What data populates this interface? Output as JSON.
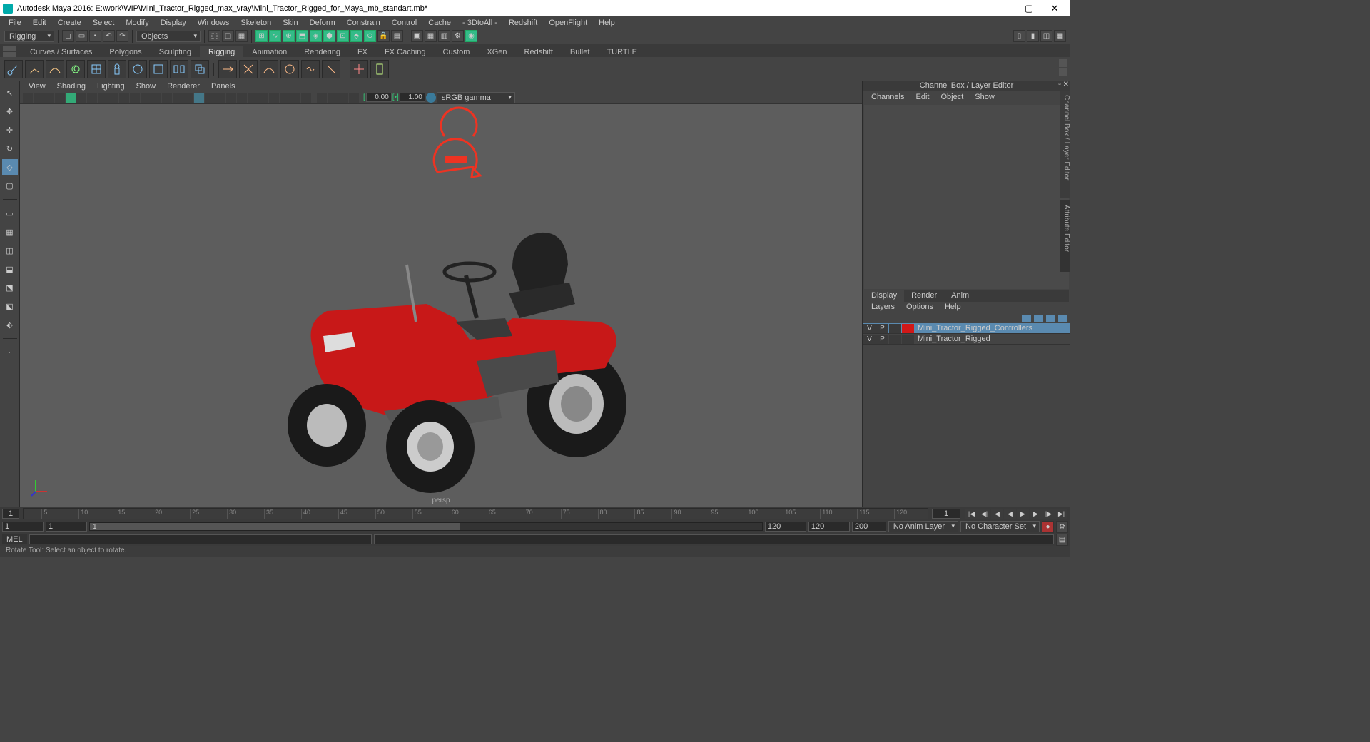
{
  "window": {
    "title": "Autodesk Maya 2016: E:\\work\\WIP\\Mini_Tractor_Rigged_max_vray\\Mini_Tractor_Rigged_for_Maya_mb_standart.mb*"
  },
  "menubar": [
    "File",
    "Edit",
    "Create",
    "Select",
    "Modify",
    "Display",
    "Windows",
    "Skeleton",
    "Skin",
    "Deform",
    "Constrain",
    "Control",
    "Cache",
    "- 3DtoAll -",
    "Redshift",
    "OpenFlight",
    "Help"
  ],
  "statusline": {
    "mode": "Rigging",
    "selmode": "Objects"
  },
  "shelf_tabs": [
    "Curves / Surfaces",
    "Polygons",
    "Sculpting",
    "Rigging",
    "Animation",
    "Rendering",
    "FX",
    "FX Caching",
    "Custom",
    "XGen",
    "Redshift",
    "Bullet",
    "TURTLE"
  ],
  "active_shelf": "Rigging",
  "panel_menus": [
    "View",
    "Shading",
    "Lighting",
    "Show",
    "Renderer",
    "Panels"
  ],
  "gamma": {
    "near": "0.00",
    "far": "1.00",
    "mode": "sRGB gamma"
  },
  "viewport": {
    "camera": "persp"
  },
  "right_panel": {
    "title": "Channel Box / Layer Editor",
    "menus": [
      "Channels",
      "Edit",
      "Object",
      "Show"
    ],
    "vtabs": [
      "Channel Box / Layer Editor",
      "Attribute Editor"
    ],
    "layer_tabs": [
      "Display",
      "Render",
      "Anim"
    ],
    "layer_menus": [
      "Layers",
      "Options",
      "Help"
    ],
    "layers": [
      {
        "v": "V",
        "p": "P",
        "color": "#d01818",
        "name": "Mini_Tractor_Rigged_Controllers",
        "selected": true
      },
      {
        "v": "V",
        "p": "P",
        "color": "#3a3a3a",
        "name": "Mini_Tractor_Rigged",
        "selected": false
      }
    ]
  },
  "timeline": {
    "current": "1",
    "current2": "1",
    "ticks": [
      "5",
      "10",
      "15",
      "20",
      "25",
      "30",
      "35",
      "40",
      "45",
      "50",
      "55",
      "60",
      "65",
      "70",
      "75",
      "80",
      "85",
      "90",
      "95",
      "100",
      "105",
      "110",
      "115",
      "120"
    ]
  },
  "range": {
    "start": "1",
    "in": "1",
    "out": "120",
    "end": "120",
    "handle": "1",
    "anim_layer": "No Anim Layer",
    "char_set": "No Character Set",
    "fps": "200"
  },
  "cmd": {
    "lang": "MEL"
  },
  "help": "Rotate Tool: Select an object to rotate."
}
